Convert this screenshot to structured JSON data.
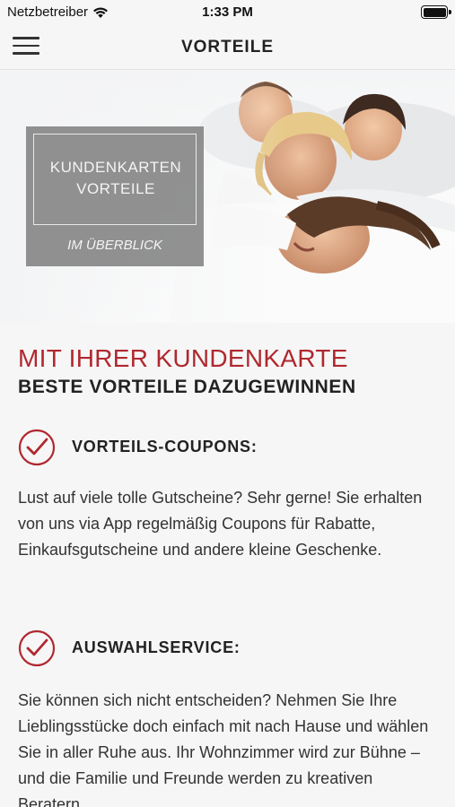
{
  "status_bar": {
    "carrier": "Netzbetreiber",
    "time": "1:33 PM"
  },
  "nav": {
    "title": "VORTEILE"
  },
  "hero": {
    "badge_line1": "KUNDENKARTEN",
    "badge_line2": "VORTEILE",
    "badge_sub": "IM ÜBERBLICK"
  },
  "content": {
    "headline": "MIT IHRER KUNDENKARTE",
    "subheadline": "BESTE VORTEILE DAZUGEWINNEN",
    "features": [
      {
        "title": "VORTEILS-COUPONS:",
        "text": "Lust auf viele tolle Gutscheine? Sehr gerne! Sie erhalten von uns via App regelmäßig Coupons für Rabatte, Einkaufsgutscheine und andere kleine Geschenke."
      },
      {
        "title": "AUSWAHLSERVICE:",
        "text": "Sie können sich nicht entscheiden? Nehmen Sie Ihre Lieblingsstücke doch einfach mit nach Hause und wählen Sie in aller Ruhe aus. Ihr Wohnzimmer wird zur Bühne – und die Familie und Freunde werden zu kreativen Beratern."
      }
    ]
  },
  "colors": {
    "accent": "#b0282f",
    "badge_bg": "#828282"
  }
}
